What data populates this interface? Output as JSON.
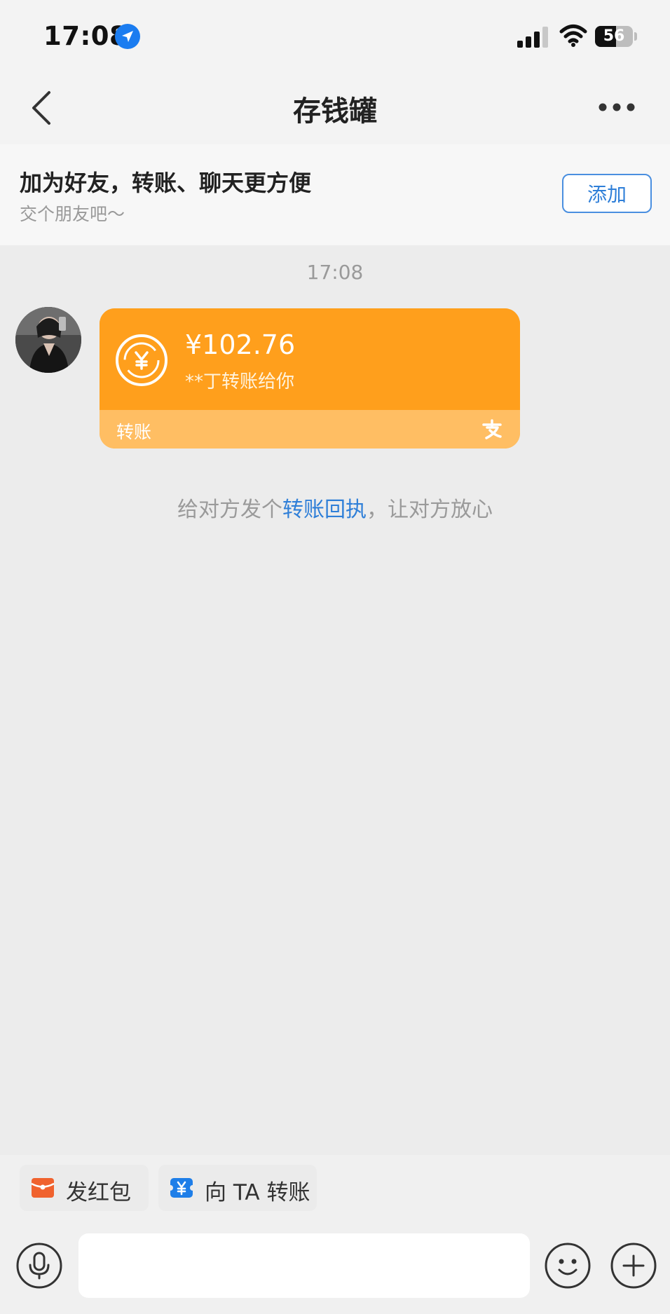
{
  "status_bar": {
    "time": "17:08",
    "battery_level": "56",
    "icons": [
      "location-arrow-icon",
      "cellular-signal-icon",
      "wifi-icon",
      "battery-icon"
    ]
  },
  "nav": {
    "title": "存钱罐",
    "back_icon": "chevron-left-icon",
    "more_icon": "ellipsis-icon"
  },
  "friend_prompt": {
    "title": "加为好友，转账、聊天更方便",
    "subtitle": "交个朋友吧～",
    "add_label": "添加"
  },
  "chat": {
    "timestamp": "17:08",
    "messages": [
      {
        "type": "transfer",
        "amount": "¥102.76",
        "description": "**丁转账给你",
        "label": "转账",
        "brand_icon": "alipay-icon",
        "card_color": "#ff9f1c"
      }
    ],
    "receipt_tip": {
      "before": "给对方发个",
      "link": "转账回执",
      "after": "，让对方放心"
    }
  },
  "quick_actions": [
    {
      "label": "发红包",
      "icon": "red-packet-icon",
      "color": "#f0622e"
    },
    {
      "label": "向 TA 转账",
      "icon": "transfer-yuan-icon",
      "color": "#1e7ee8"
    }
  ],
  "input_bar": {
    "placeholder": "",
    "voice_icon": "microphone-icon",
    "emoji_icon": "smiley-icon",
    "plus_icon": "plus-icon"
  },
  "colors": {
    "accent_blue": "#2f7fd8",
    "transfer_orange": "#ff9f1c",
    "background": "#ececec"
  }
}
